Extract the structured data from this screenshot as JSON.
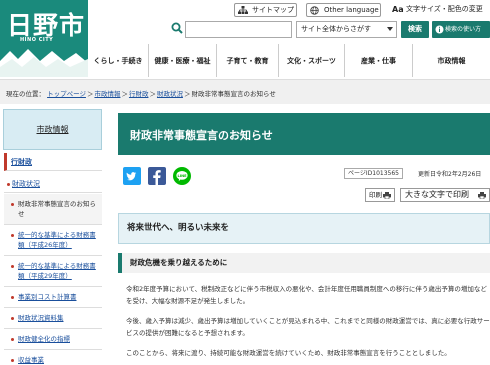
{
  "header": {
    "logo_name": "日野市",
    "logo_sub": "HINO CITY",
    "sitemap_label": "サイトマップ",
    "language_label": "Other language",
    "text_size_label": "文字サイズ・配色の変更",
    "search_placeholder": "",
    "search_scope": "サイト全体からさがす",
    "search_button": "検索",
    "howto_button": "検索の使い方"
  },
  "nav": {
    "items": [
      {
        "label": "くらし・手続き"
      },
      {
        "label": "健康・医療・福祉"
      },
      {
        "label": "子育て・教育"
      },
      {
        "label": "文化・スポーツ"
      },
      {
        "label": "産業・仕事"
      },
      {
        "label": "市政情報"
      }
    ]
  },
  "breadcrumb": {
    "prefix": "現在の位置：",
    "items": [
      "トップページ",
      "市政情報",
      "行財政",
      "財政状況"
    ],
    "current": "財政非常事態宣言のお知らせ"
  },
  "sidebar": {
    "heading": "市政情報",
    "category": "行財政",
    "subcategory": "財政状況",
    "items": [
      {
        "label": "財政非常事態宣言のお知らせ",
        "current": true
      },
      {
        "label": "統一的な基準による財務書類（平成26年度）",
        "current": false
      },
      {
        "label": "統一的な基準による財務書類（平成29年度）",
        "current": false
      },
      {
        "label": "事業別コスト計算書",
        "current": false
      },
      {
        "label": "財政状況資料集",
        "current": false
      },
      {
        "label": "財政健全化の指標",
        "current": false
      },
      {
        "label": "収益事業",
        "current": false
      }
    ]
  },
  "main": {
    "title": "財政非常事態宣言のお知らせ",
    "page_id": "ページID1013565",
    "updated": "更新日令和2年2月26日",
    "print_label": "印刷",
    "print_large_label": "大きな文字で印刷",
    "heading2": "将来世代へ、明るい未来を",
    "heading3": "財政危機を乗り越えるために",
    "paragraphs": [
      "令和2年度予算において、税制改正などに伴う市税収入の悪化や、会計年度任用職員制度への移行に伴う歳出予算の増加などを受け、大幅な財源不足が発生しました。",
      "今後、歳入予算は減少、歳出予算は増加していくことが見込まれる中、これまでと同様の財政運営では、真に必要な行政サービスの提供が困難になると予想されます。",
      "このことから、将来に渡り、持続可能な財政運営を続けていくため、財政非常事態宣言を行うこととしました。"
    ]
  },
  "colors": {
    "brand_teal": "#1a7a6e",
    "accent_red": "#c0392b",
    "link_blue": "#1a4f9c"
  }
}
